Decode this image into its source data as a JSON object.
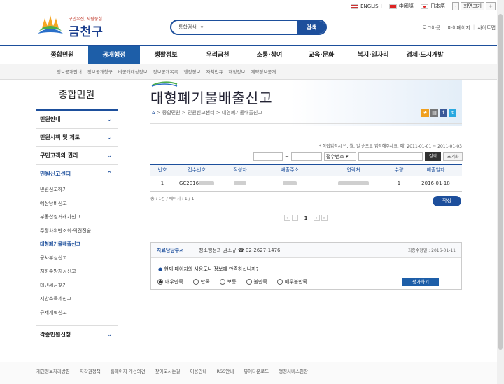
{
  "utility": {
    "english": "ENGLISH",
    "chinese": "中國語",
    "japanese": "日本語",
    "zoom_reset": "화면크기",
    "zoom_minus": "-",
    "zoom_plus": "+"
  },
  "logo": {
    "slogan": "구민우선, 사람중심",
    "name": "금천구"
  },
  "search": {
    "scope": "통합검색",
    "button": "검색",
    "placeholder": ""
  },
  "top_links": [
    "로그아웃",
    "마이페이지",
    "사이트맵"
  ],
  "gnb": [
    "종합민원",
    "공개행정",
    "생활정보",
    "우리금천",
    "소통·참여",
    "교육·문화",
    "복지·일자리",
    "경제·도시개발"
  ],
  "gnb_active_index": 1,
  "sub_menu": [
    "정보공개안내",
    "정보공개청구",
    "비공개대상정보",
    "정보공개목록",
    "행정정보",
    "자치법규",
    "재정정보",
    "계약정보공개"
  ],
  "lnb": {
    "title": "종합민원",
    "groups": [
      {
        "label": "민원안내",
        "chevron": "v"
      },
      {
        "label": "민원시책 및 제도",
        "chevron": "v"
      },
      {
        "label": "구민고객의 권리",
        "chevron": "v"
      },
      {
        "label": "민원신고센터",
        "chevron": "^"
      }
    ],
    "items": [
      "민원신고하기",
      "예산낭비신고",
      "부동산실거래가신고",
      "주정차위반조회·의견진술",
      "대형폐기물배출신고",
      "공사부실신고",
      "지하수방치공신고",
      "더낸세금찾기",
      "지방소득세신고",
      "규제개혁신고"
    ],
    "active_item": "대형폐기물배출신고",
    "last_group": "각종민원신청"
  },
  "page": {
    "title": "대형폐기물배출신고",
    "breadcrumb": [
      "종합민원",
      "민원신고센터",
      "대형폐기물배출신고"
    ]
  },
  "filter": {
    "note": "* 작접입력시 년, 월, 일 순으로 입력해주세요. 예) 2011-01-01 ~ 2011-01-03",
    "tilde": "~",
    "select": "접수번호",
    "search_btn": "검색",
    "reset_btn": "초기화"
  },
  "table": {
    "headers": [
      "번호",
      "접수번호",
      "작성자",
      "배출주소",
      "연락처",
      "수량",
      "배출일자"
    ],
    "rows": [
      {
        "no": "1",
        "receipt": "GC2016",
        "qty": "1",
        "date": "2016-01-18"
      }
    ]
  },
  "count": "총 : 1건 / 페이지 : 1 / 1",
  "write_button": "작성",
  "pager": {
    "first": "«",
    "prev": "‹",
    "current": "1",
    "next": "›",
    "last": "»"
  },
  "survey": {
    "dept_label": "자료담당부서",
    "dept_info": "청소행정과 권소규 ☎ 02-2627-1476",
    "updated": "최종수정일 : 2016-01-11",
    "question": "현재 페이지의 사용도나 정보에 만족하십니까?",
    "options": [
      "매우만족",
      "만족",
      "보통",
      "불만족",
      "매우불만족"
    ],
    "selected": "매우만족",
    "submit": "평가하기"
  },
  "footer": [
    "개인정보처리방침",
    "저작권정책",
    "홈페이지 개선의견",
    "찾아오시는길",
    "이용안내",
    "RSS안내",
    "뷰어다운로드",
    "행정서비스헌장"
  ],
  "colors": {
    "primary": "#1d4f9c",
    "active_tab": "#1d5ea8"
  }
}
